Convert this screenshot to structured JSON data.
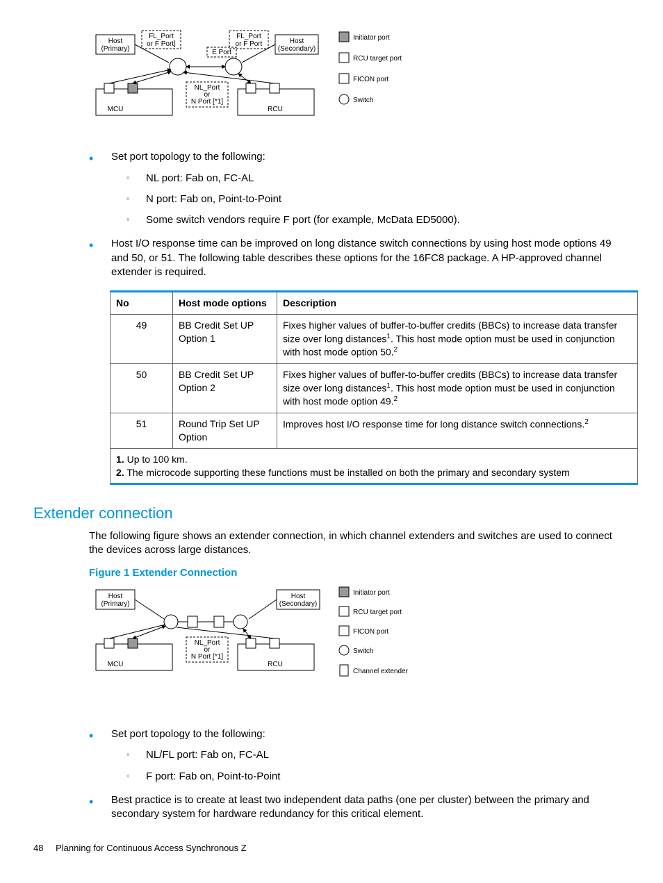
{
  "diagram1": {
    "host_primary": "Host\n(Primary)",
    "host_secondary": "Host\n(Secondary)",
    "fl_port_f_port_1": "FL_Port\nor F Port]",
    "fl_port_f_port_2": "FL_Port\nor F Port",
    "e_port": "E Port",
    "nl_port": "NL_Port\nor\nN Port [*1]",
    "mcu": "MCU",
    "rcu": "RCU",
    "legend": {
      "initiator": "Initiator port",
      "rcu_target": "RCU target port",
      "ficon": "FICON port",
      "switch": "Switch"
    }
  },
  "bullets1": {
    "b1": "Set port topology to the following:",
    "b1s1": "NL port: Fab on, FC-AL",
    "b1s2": "N port: Fab on, Point-to-Point",
    "b1s3": "Some switch vendors require F port (for example, McData ED5000).",
    "b2": "Host I/O response time can be improved on long distance switch connections by using host mode options 49 and 50, or 51. The following table describes these options for the 16FC8 package. A HP-approved channel extender is required."
  },
  "table": {
    "headers": {
      "no": "No",
      "opts": "Host mode options",
      "desc": "Description"
    },
    "row1": {
      "no": "49",
      "opt": "BB Credit Set UP Option 1",
      "desc_a": "Fixes higher values of buffer-to-buffer credits (BBCs) to increase data transfer size over long distances",
      "desc_b": ". This host mode option must be used in conjunction with host mode option 50."
    },
    "row2": {
      "no": "50",
      "opt": "BB Credit Set UP Option 2",
      "desc_a": "Fixes higher values of buffer-to-buffer credits (BBCs) to increase data transfer size over long distances",
      "desc_b": ". This host mode option must be used in conjunction with host mode option 49."
    },
    "row3": {
      "no": "51",
      "opt": "Round Trip Set UP Option",
      "desc": "Improves host I/O response time for long distance switch connections."
    },
    "footnote1_num": "1.",
    "footnote1": " Up to 100 km.",
    "footnote2_num": "2.",
    "footnote2": " The microcode supporting these functions must be installed on both the primary and secondary system"
  },
  "section2": {
    "heading": "Extender connection",
    "para": "The following figure shows an extender connection, in which channel extenders and switches are used to connect the devices across large distances.",
    "fig_caption": "Figure 1 Extender Connection"
  },
  "diagram2": {
    "host_primary": "Host\n(Primary)",
    "host_secondary": "Host\n(Secondary)",
    "nl_port": "NL_Port\nor\nN Port [*1]",
    "mcu": "MCU",
    "rcu": "RCU",
    "legend": {
      "initiator": "Initiator port",
      "rcu_target": "RCU target port",
      "ficon": "FICON port",
      "switch": "Switch",
      "extender": "Channel extender"
    }
  },
  "bullets2": {
    "b1": "Set port topology to the following:",
    "b1s1": "NL/FL port: Fab on, FC-AL",
    "b1s2": "F port: Fab on, Point-to-Point",
    "b2": "Best practice is to create at least two independent data paths (one per cluster) between the primary and secondary system for hardware redundancy for this critical element."
  },
  "footer": {
    "page": "48",
    "chapter": "Planning for Continuous Access Synchronous Z"
  }
}
